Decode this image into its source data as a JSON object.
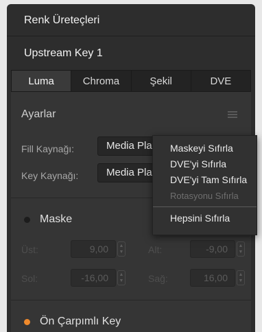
{
  "panel": {
    "title": "Renk Üreteçleri",
    "subtitle": "Upstream Key 1"
  },
  "tabs": [
    {
      "label": "Luma",
      "active": true
    },
    {
      "label": "Chroma",
      "active": false
    },
    {
      "label": "Şekil",
      "active": false
    },
    {
      "label": "DVE",
      "active": false
    }
  ],
  "settings": {
    "title": "Ayarlar",
    "fill_label": "Fill Kaynağı:",
    "fill_value": "Media Player 1",
    "key_label": "Key Kaynağı:",
    "key_value": "Media Player 1"
  },
  "mask": {
    "label": "Maske",
    "enabled": false,
    "top_label": "Üst:",
    "top_value": "9,00",
    "bottom_label": "Alt:",
    "bottom_value": "-9,00",
    "left_label": "Sol:",
    "left_value": "-16,00",
    "right_label": "Sağ:",
    "right_value": "16,00"
  },
  "premultiplied": {
    "label": "Ön Çarpımlı Key",
    "enabled": true
  },
  "context_menu": {
    "items": [
      {
        "label": "Maskeyi Sıfırla",
        "enabled": true
      },
      {
        "label": "DVE'yi Sıfırla",
        "enabled": true
      },
      {
        "label": "DVE'yi Tam Sıfırla",
        "enabled": true
      },
      {
        "label": "Rotasyonu Sıfırla",
        "enabled": false
      }
    ],
    "reset_all": "Hepsini Sıfırla"
  },
  "colors": {
    "accent_led": "#f08a2c",
    "panel_bg": "#2d2d2d"
  }
}
